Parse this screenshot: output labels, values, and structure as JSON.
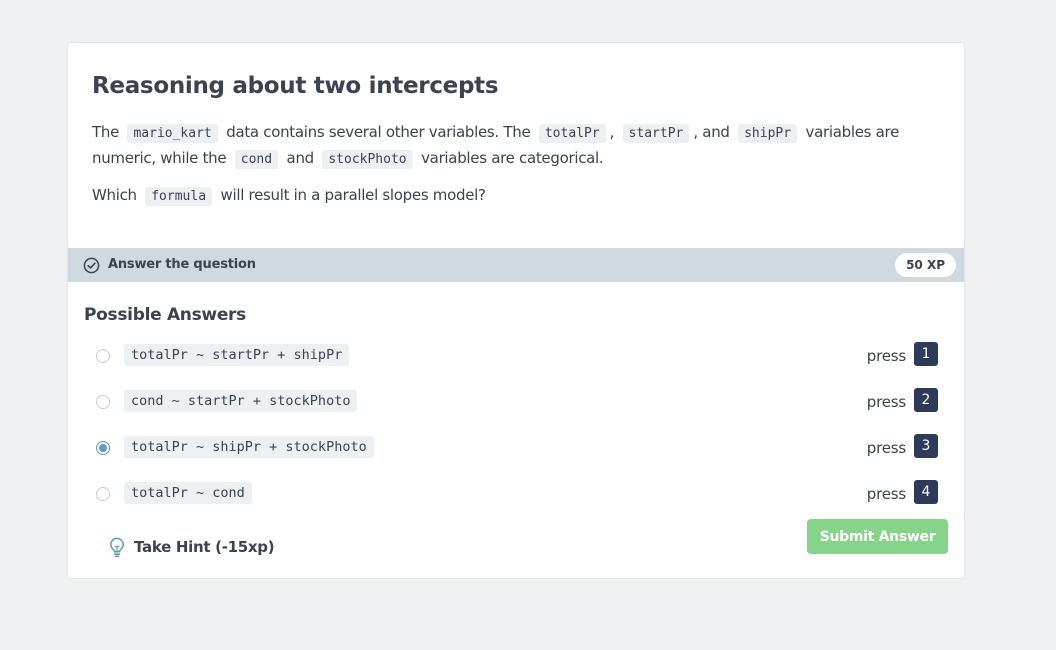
{
  "exercise": {
    "title": "Reasoning about two intercepts",
    "p1": {
      "t1": "The",
      "c1": "mario_kart",
      "t2": "data contains several other variables. The",
      "c2": "totalPr",
      "t3": ",",
      "c3": "startPr",
      "t4": ", and",
      "c4": "shipPr",
      "t5": "variables are numeric, while the",
      "c5": "cond",
      "t6": "and",
      "c6": "stockPhoto",
      "t7": "variables are categorical."
    },
    "p2": {
      "t1": "Which",
      "c1": "formula",
      "t2": "will result in a parallel slopes model?"
    }
  },
  "answer_bar": {
    "label": "Answer the question",
    "xp": "50 XP",
    "icon": "check-circle-icon"
  },
  "possible_answers": {
    "title": "Possible Answers",
    "options": [
      {
        "code": "totalPr ~ startPr + shipPr",
        "press": "press",
        "key": "1",
        "selected": false
      },
      {
        "code": "cond ~ startPr + stockPhoto",
        "press": "press",
        "key": "2",
        "selected": false
      },
      {
        "code": "totalPr ~ shipPr + stockPhoto",
        "press": "press",
        "key": "3",
        "selected": true
      },
      {
        "code": "totalPr ~ cond",
        "press": "press",
        "key": "4",
        "selected": false
      }
    ]
  },
  "hint": {
    "label": "Take Hint (-15xp)",
    "icon": "lightbulb-icon"
  },
  "submit": {
    "label": "Submit Answer"
  },
  "colors": {
    "accent": "#5e9eba",
    "submit": "#86d48a",
    "key_bg": "#2d3a5a",
    "bar_bg": "#d0d9e0"
  }
}
